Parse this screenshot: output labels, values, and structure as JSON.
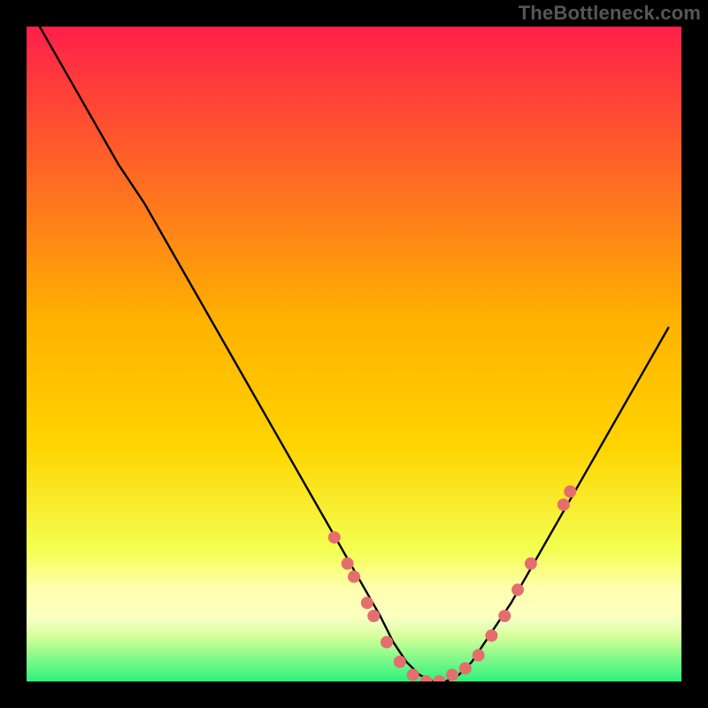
{
  "watermark": "TheBottleneck.com",
  "colors": {
    "gradient_top": "#ff1f49",
    "gradient_mid": "#ffd400",
    "gradient_low": "#e9ff60",
    "gradient_band": "#ffffb0",
    "gradient_bottom": "#2cf27b",
    "curve": "#000000",
    "markers": "#e46e6e",
    "frame": "#000000"
  },
  "chart_data": {
    "type": "line",
    "title": "",
    "xlabel": "",
    "ylabel": "",
    "xlim": [
      0,
      100
    ],
    "ylim": [
      0,
      100
    ],
    "series": [
      {
        "name": "bottleneck-curve",
        "x": [
          2,
          6,
          10,
          14,
          18,
          22,
          26,
          30,
          34,
          38,
          42,
          46,
          50,
          54,
          56,
          58,
          60,
          62,
          64,
          66,
          68,
          70,
          74,
          78,
          82,
          86,
          90,
          94,
          98
        ],
        "y": [
          100,
          93,
          86,
          79,
          73,
          66,
          59,
          52,
          45,
          38,
          31,
          24,
          17,
          10,
          6,
          3,
          1,
          0,
          0,
          1,
          3,
          6,
          12,
          19,
          26,
          33,
          40,
          47,
          54
        ]
      }
    ],
    "markers": {
      "name": "sample-points",
      "x": [
        47,
        49,
        50,
        52,
        53,
        55,
        57,
        59,
        61,
        63,
        65,
        67,
        69,
        71,
        73,
        75,
        77,
        82,
        83
      ],
      "y": [
        22,
        18,
        16,
        12,
        10,
        6,
        3,
        1,
        0,
        0,
        1,
        2,
        4,
        7,
        10,
        14,
        18,
        27,
        29
      ]
    }
  }
}
